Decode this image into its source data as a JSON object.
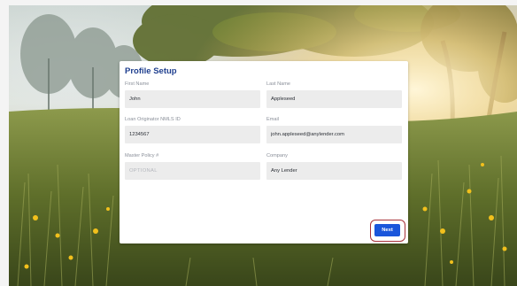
{
  "form": {
    "title": "Profile Setup",
    "fields": [
      {
        "label": "First Name",
        "value": "John",
        "placeholder": ""
      },
      {
        "label": "Last Name",
        "value": "Appleseed",
        "placeholder": ""
      },
      {
        "label": "Loan Originator NMLS ID",
        "value": "1234567",
        "placeholder": ""
      },
      {
        "label": "Email",
        "value": "john.appleseed@anylender.com",
        "placeholder": ""
      },
      {
        "label": "Master Policy #",
        "value": "",
        "placeholder": "OPTIONAL"
      },
      {
        "label": "Company",
        "value": "Any Lender",
        "placeholder": ""
      }
    ],
    "next_label": "Next"
  },
  "colors": {
    "title": "#1f3f8f",
    "primary_button": "#1a56db",
    "highlight_ring": "#a8323a",
    "input_bg": "#ececec"
  }
}
